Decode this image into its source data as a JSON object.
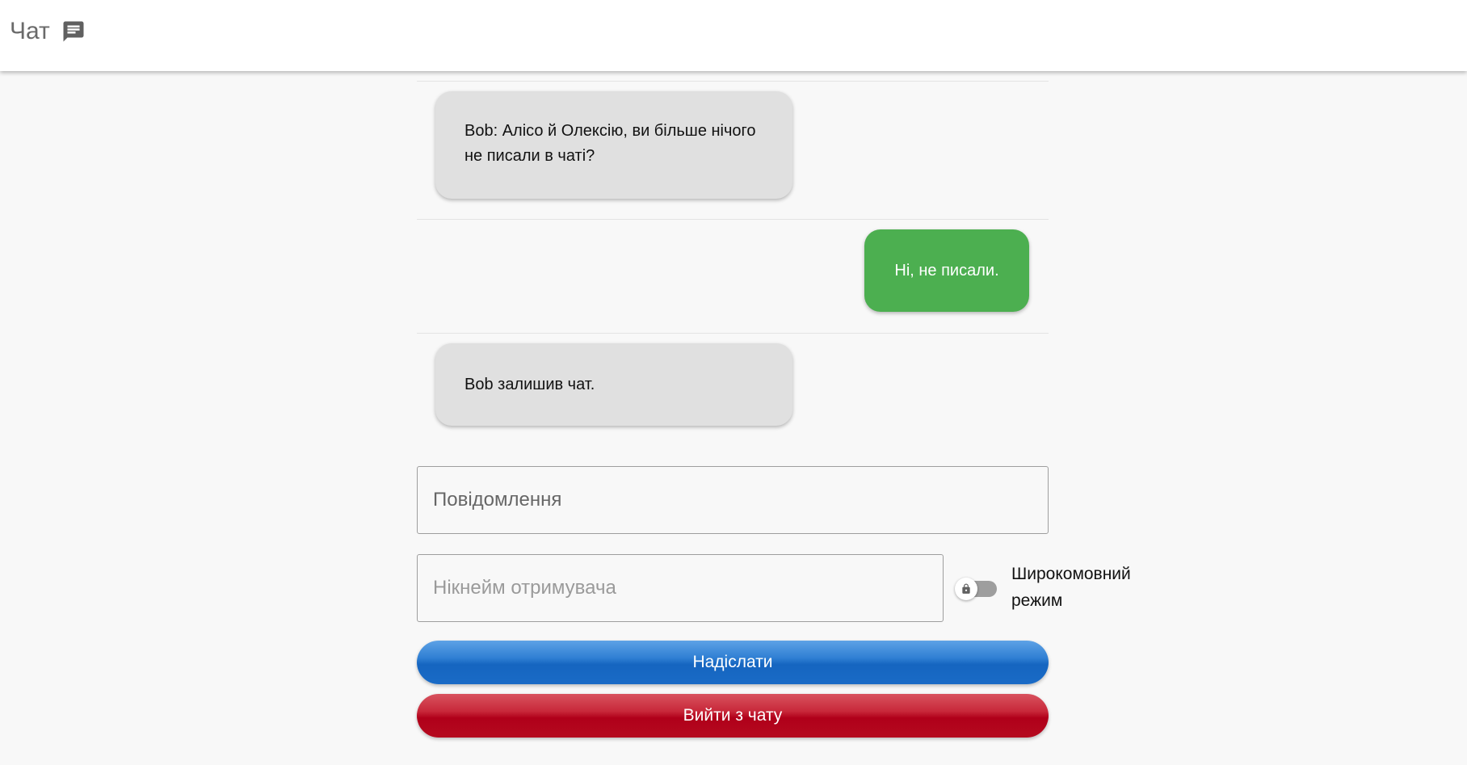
{
  "app": {
    "title": "Чат",
    "title_icon": "chat-icon"
  },
  "messages": [
    {
      "sender": "other",
      "text": "Bob: Алісо й Олексію, ви більше нічого не писали в чаті?"
    },
    {
      "sender": "own",
      "text": "Ні, не писали."
    },
    {
      "sender": "other",
      "text": "Bob залишив чат."
    }
  ],
  "form": {
    "message_placeholder": "Повідомлення",
    "recipient_placeholder": "Нікнейм отримувача",
    "broadcast_label": "Широкомовний режим",
    "broadcast_enabled": false,
    "send_label": "Надіслати",
    "leave_label": "Вийти з чату"
  },
  "colors": {
    "own_bubble": "#4caf50",
    "other_bubble": "#e0e0e0",
    "send_button": "#1565c0",
    "leave_button": "#b0001a"
  }
}
